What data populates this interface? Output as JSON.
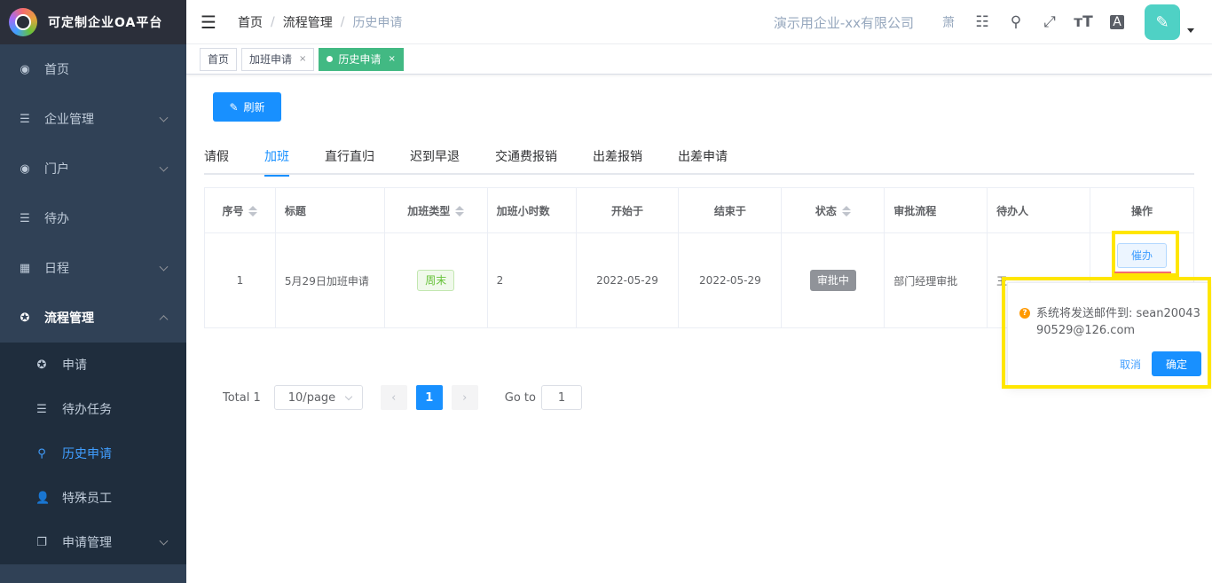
{
  "app": {
    "title": "可定制企业OA平台"
  },
  "sidebar": {
    "items": [
      {
        "label": "首页",
        "icon": "dashboard-icon"
      },
      {
        "label": "企业管理",
        "icon": "list-icon"
      },
      {
        "label": "门户",
        "icon": "dashboard-icon"
      },
      {
        "label": "待办",
        "icon": "list-icon"
      },
      {
        "label": "日程",
        "icon": "grid-icon"
      },
      {
        "label": "流程管理",
        "icon": "lifebuoy-icon"
      }
    ],
    "subitems": [
      {
        "label": "申请",
        "icon": "lifebuoy-icon"
      },
      {
        "label": "待办任务",
        "icon": "list-icon"
      },
      {
        "label": "历史申请",
        "icon": "search-icon"
      },
      {
        "label": "特殊员工",
        "icon": "user-icon"
      },
      {
        "label": "申请管理",
        "icon": "copy-icon"
      }
    ]
  },
  "navbar": {
    "breadcrumb": [
      "首页",
      "流程管理",
      "历史申请"
    ],
    "company": "演示用企业-xx有限公司",
    "user_char": "萧"
  },
  "tags": [
    {
      "label": "首页"
    },
    {
      "label": "加班申请"
    },
    {
      "label": "历史申请"
    }
  ],
  "toolbar": {
    "refresh_label": "刷新"
  },
  "tabs": [
    "请假",
    "加班",
    "直行直归",
    "迟到早退",
    "交通费报销",
    "出差报销",
    "出差申请"
  ],
  "table": {
    "headers": [
      "序号",
      "标题",
      "加班类型",
      "加班小时数",
      "开始于",
      "结束于",
      "状态",
      "审批流程",
      "待办人",
      "操作"
    ],
    "rows": [
      {
        "index": "1",
        "title": "5月29日加班申请",
        "type": "周末",
        "hours": "2",
        "start": "2022-05-29",
        "end": "2022-05-29",
        "status": "审批中",
        "flow": "部门经理审批",
        "assignee": "王",
        "action": "催办"
      }
    ]
  },
  "pagination": {
    "total_label": "Total 1",
    "page_size": "10/page",
    "current_page": "1",
    "goto_label": "Go to",
    "goto_value": "1"
  },
  "popconfirm": {
    "message": "系统将发送邮件到: sean2004390529@126.com",
    "cancel": "取消",
    "confirm": "确定"
  },
  "colors": {
    "sidebar_bg": "#304156",
    "primary": "#1890ff",
    "active_tag": "#42b983",
    "highlight": "#ffe600"
  }
}
